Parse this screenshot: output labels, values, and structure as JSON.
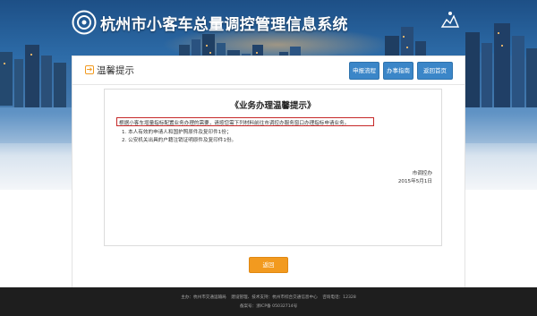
{
  "header": {
    "title": "杭州市小客车总量调控管理信息系统",
    "logo_icon": "ring-logo-icon",
    "colors": {
      "banner_top": "#1d4f86",
      "banner_bottom": "#f4f6f9"
    }
  },
  "panel": {
    "title": "温馨提示",
    "buttons": {
      "apply": "申报流程",
      "guide": "办事指南",
      "home": "返回首页"
    },
    "colors": {
      "button": "#3b86c8",
      "accent": "#f29a1f"
    }
  },
  "notice": {
    "title": "《业务办理温馨提示》",
    "intro": "根据小客车增量指标配置业务办理的需要，请按您需下列材料前往市调控办服务窗口办理指标申请业务。",
    "items": [
      "1. 本人有效的申请人和国护照原件及复印件1份；",
      "2. 公安机关出具的户籍注销证明原件及复印件1份。"
    ],
    "signature": "市调控办",
    "date": "2015年5月1日"
  },
  "actions": {
    "back": "返回"
  },
  "footer": {
    "sponsor": "主办：杭州市交通运输局",
    "management": "建设管理、技术支持：杭州市综合交通信息中心",
    "hotline": "咨询电话：12328",
    "icp": "备案号：浙ICP备 05032714号"
  }
}
